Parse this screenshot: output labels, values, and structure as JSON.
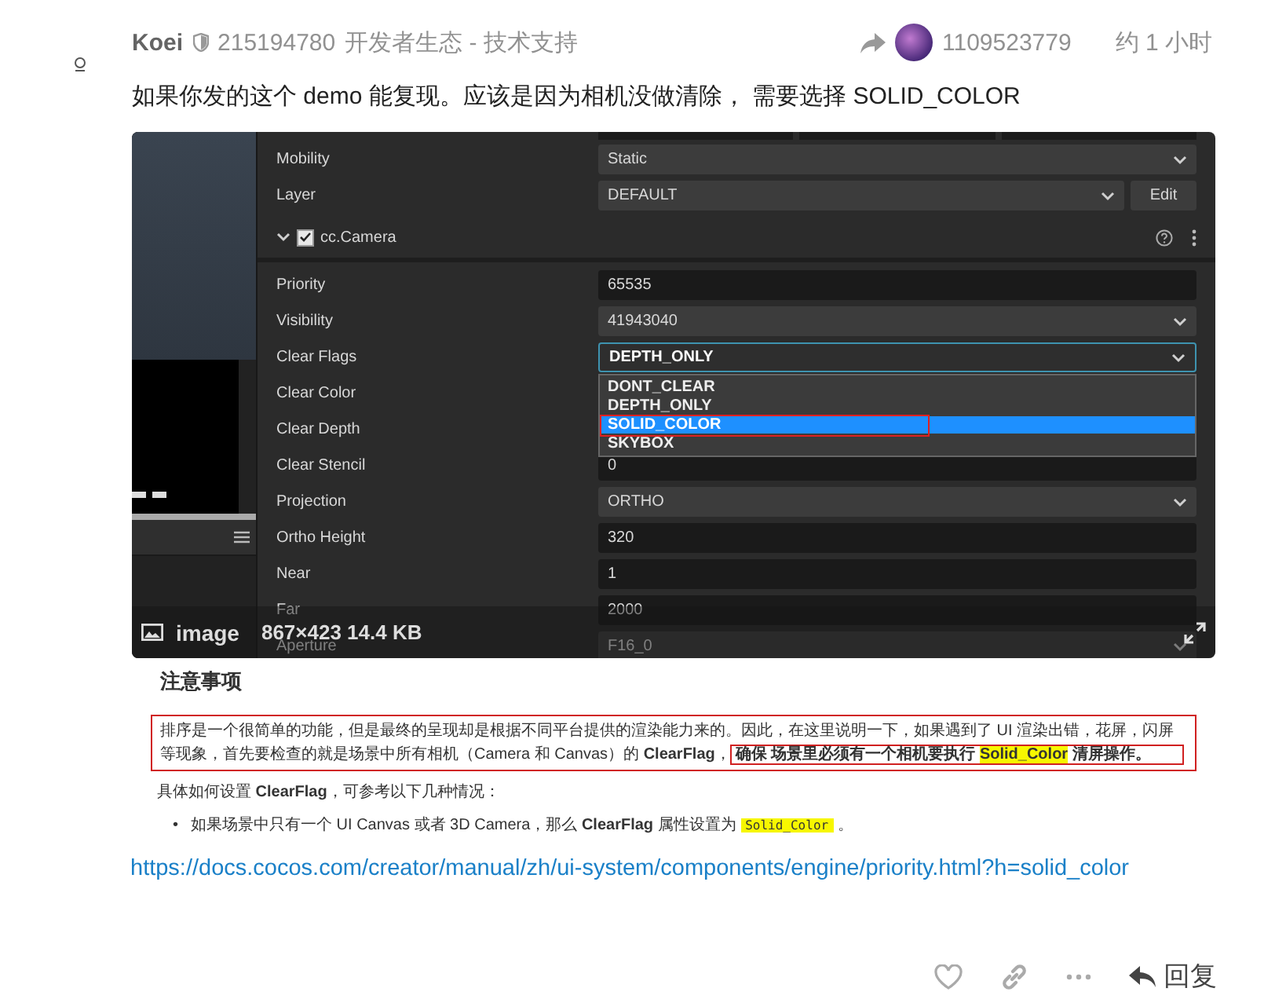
{
  "post": {
    "author": "Koei",
    "user_id": "215194780",
    "category": "开发者生态 - 技术支持",
    "reply_to": "1109523779",
    "time": "约 1 小时",
    "body": "如果你发的这个 demo 能复现。应该是因为相机没做清除， 需要选择 SOLID_COLOR"
  },
  "screenshot": {
    "rows_top": [
      {
        "kind": "select",
        "label": "Mobility",
        "value": "Static"
      },
      {
        "kind": "select_button",
        "label": "Layer",
        "value": "DEFAULT",
        "button": "Edit"
      }
    ],
    "component": {
      "title": "cc.Camera",
      "checked": true,
      "expanded": true
    },
    "rows": [
      {
        "kind": "input",
        "label": "Priority",
        "value": "65535"
      },
      {
        "kind": "select",
        "label": "Visibility",
        "value": "41943040"
      },
      {
        "kind": "dropdown",
        "label": "Clear Flags",
        "value": "DEPTH_ONLY"
      },
      {
        "kind": "hidden",
        "label": "Clear Color"
      },
      {
        "kind": "hidden",
        "label": "Clear Depth"
      },
      {
        "kind": "input",
        "label": "Clear Stencil",
        "value": "0"
      },
      {
        "kind": "select",
        "label": "Projection",
        "value": "ORTHO"
      },
      {
        "kind": "input",
        "label": "Ortho Height",
        "value": "320"
      },
      {
        "kind": "input",
        "label": "Near",
        "value": "1"
      },
      {
        "kind": "input",
        "label": "Far",
        "value": "2000"
      },
      {
        "kind": "select",
        "label": "Aperture",
        "value": "F16_0"
      }
    ],
    "dropdown_options": [
      {
        "label": "DONT_CLEAR",
        "selected": false
      },
      {
        "label": "DEPTH_ONLY",
        "selected": false
      },
      {
        "label": "SOLID_COLOR",
        "selected": true
      },
      {
        "label": "SKYBOX",
        "selected": false
      }
    ],
    "image_label": "image",
    "image_meta": "867×423 14.4 KB"
  },
  "doc": {
    "heading": "注意事项",
    "paragraph": "排序是一个很简单的功能，但是最终的呈现却是根据不同平台提供的渲染能力来的。因此，在这里说明一下，如果遇到了 UI 渲染出错，花屏，闪屏等现象，首先要检查的就是场景中所有相机（Camera 和 Canvas）的 **ClearFlag**，",
    "boxed": "确保 场景里必须有一个相机要执行 **Solid_Color** 清屏操作。",
    "line": "具体如何设置 **ClearFlag**，可参考以下几种情况：",
    "bullet": {
      "marker": "•",
      "before": "如果场景中只有一个 UI Canvas 或者 3D Camera，那么 **ClearFlag** 属性设置为",
      "code": "Solid_Color",
      "after": "。"
    }
  },
  "link": "https://docs.cocos.com/creator/manual/zh/ui-system/components/engine/priority.html?h=solid_color",
  "actions": {
    "reply": "回复"
  }
}
